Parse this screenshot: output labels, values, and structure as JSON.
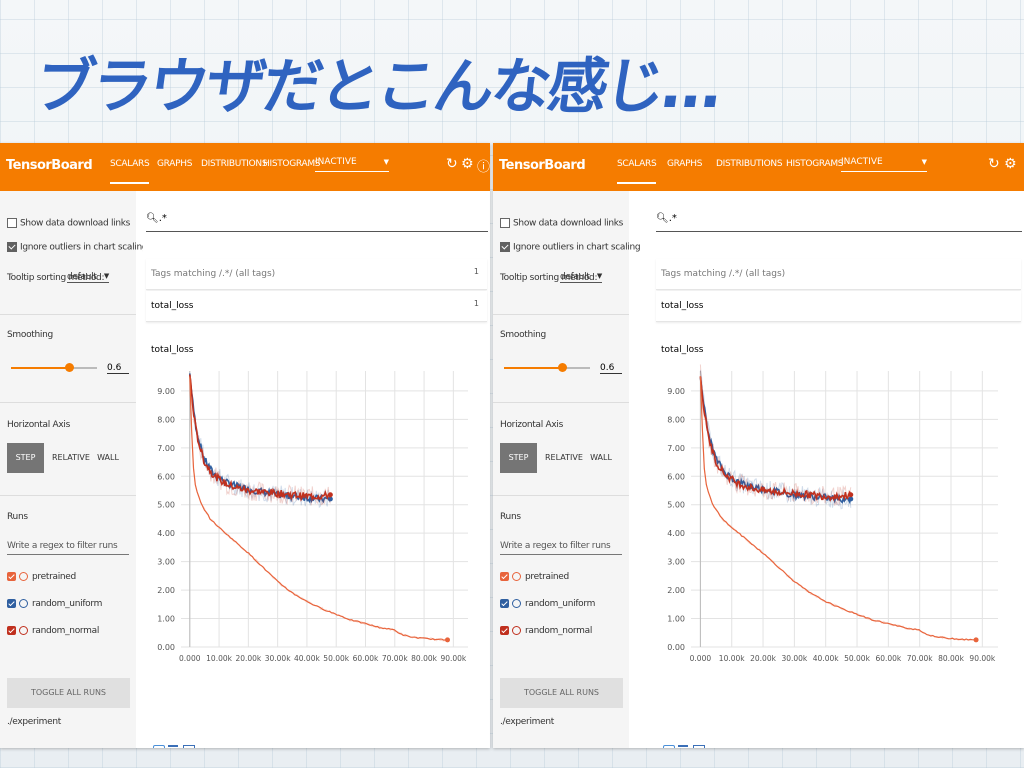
{
  "slide_title": "ブラウザだとこんな感じ…",
  "colors": {
    "orange": "#f57c00",
    "pretrained": "#e8643c",
    "random_uniform": "#2f5fa0",
    "random_normal": "#c0301e"
  },
  "panels": [
    {
      "brand": "TensorBoard",
      "nav": [
        "SCALARS",
        "GRAPHS",
        "DISTRIBUTIONS",
        "HISTOGRAMS"
      ],
      "inactive_label": "INACTIVE",
      "icons": [
        "refresh-icon",
        "settings-icon",
        "help-icon"
      ],
      "sidebar": {
        "show_download": "Show data download links",
        "ignore_outliers": "Ignore outliers in chart scaling",
        "tooltip_label": "Tooltip sorting method:",
        "tooltip_value": "default",
        "smoothing_label": "Smoothing",
        "smoothing_value": "0.6",
        "axis_label": "Horizontal Axis",
        "axis_options": [
          "STEP",
          "RELATIVE",
          "WALL"
        ],
        "runs_label": "Runs",
        "runs_filter_placeholder": "Write a regex to filter runs",
        "runs": [
          "pretrained",
          "random_uniform",
          "random_normal"
        ],
        "toggle_all": "TOGGLE ALL RUNS",
        "experiment": "./experiment"
      },
      "main": {
        "search_value": ".*",
        "tags_matching": "Tags matching /.*/ (all tags)",
        "tags_count": "1",
        "tag_name": "total_loss",
        "tag_count": "1",
        "chart_title": "total_loss"
      }
    },
    {
      "brand": "TensorBoard",
      "nav": [
        "SCALARS",
        "GRAPHS",
        "DISTRIBUTIONS",
        "HISTOGRAMS"
      ],
      "inactive_label": "INACTIVE",
      "icons": [
        "refresh-icon",
        "settings-icon"
      ],
      "sidebar": {
        "show_download": "Show data download links",
        "ignore_outliers": "Ignore outliers in chart scaling",
        "tooltip_label": "Tooltip sorting method:",
        "tooltip_value": "default",
        "smoothing_label": "Smoothing",
        "smoothing_value": "0.6",
        "axis_label": "Horizontal Axis",
        "axis_options": [
          "STEP",
          "RELATIVE",
          "WALL"
        ],
        "runs_label": "Runs",
        "runs_filter_placeholder": "Write a regex to filter runs",
        "runs": [
          "pretrained",
          "random_uniform",
          "random_normal"
        ],
        "toggle_all": "TOGGLE ALL RUNS",
        "experiment": "./experiment"
      },
      "main": {
        "search_value": ".*",
        "tags_matching": "Tags matching /.*/ (all tags)",
        "tags_count": "",
        "tag_name": "total_loss",
        "tag_count": "",
        "chart_title": "total_loss"
      }
    }
  ],
  "chart_data": {
    "type": "line",
    "title": "total_loss",
    "xlabel": "",
    "ylabel": "",
    "x_ticks": [
      "0.000",
      "10.00k",
      "20.00k",
      "30.00k",
      "40.00k",
      "50.00k",
      "60.00k",
      "70.00k",
      "80.00k",
      "90.00k"
    ],
    "y_ticks": [
      "0.00",
      "1.00",
      "2.00",
      "3.00",
      "4.00",
      "5.00",
      "6.00",
      "7.00",
      "8.00",
      "9.00"
    ],
    "xlim": [
      -3000,
      95000
    ],
    "ylim": [
      0,
      9.7
    ],
    "grid": true,
    "series": [
      {
        "name": "random_uniform",
        "x": [
          0,
          1000,
          2000,
          3000,
          5000,
          8000,
          12000,
          16000,
          20000,
          25000,
          30000,
          35000,
          40000,
          45000,
          48000
        ],
        "y": [
          9.6,
          8.6,
          7.8,
          7.3,
          6.6,
          6.1,
          5.8,
          5.65,
          5.55,
          5.45,
          5.35,
          5.3,
          5.25,
          5.2,
          5.2
        ]
      },
      {
        "name": "random_normal",
        "x": [
          0,
          1000,
          2000,
          3000,
          5000,
          8000,
          12000,
          16000,
          20000,
          25000,
          30000,
          35000,
          40000,
          45000,
          48000
        ],
        "y": [
          9.6,
          8.5,
          7.7,
          7.2,
          6.5,
          6.05,
          5.75,
          5.6,
          5.5,
          5.45,
          5.4,
          5.35,
          5.3,
          5.3,
          5.35
        ]
      },
      {
        "name": "pretrained",
        "x": [
          0,
          1000,
          2000,
          4000,
          7000,
          10000,
          15000,
          20000,
          25000,
          30000,
          35000,
          40000,
          45000,
          50000,
          55000,
          60000,
          65000,
          70000,
          72000,
          75000,
          80000,
          85000,
          88000
        ],
        "y": [
          9.5,
          6.5,
          5.6,
          5.0,
          4.5,
          4.2,
          3.75,
          3.3,
          2.8,
          2.3,
          1.9,
          1.6,
          1.35,
          1.15,
          0.95,
          0.82,
          0.68,
          0.6,
          0.45,
          0.36,
          0.3,
          0.26,
          0.25
        ]
      }
    ]
  }
}
